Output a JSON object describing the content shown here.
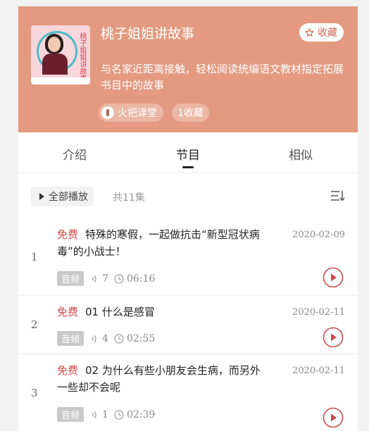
{
  "album": {
    "title": "桃子姐姐讲故事",
    "cover_text": "桃子姐姐讲故事",
    "favorite_label": "收藏",
    "description": "与名家近距离接触，轻松阅读统编语文教材指定拓展书目中的故事",
    "brand": "火把课堂",
    "favorites_count": "1收藏"
  },
  "tabs": [
    {
      "label": "介绍",
      "active": false
    },
    {
      "label": "节目",
      "active": true
    },
    {
      "label": "相似",
      "active": false
    }
  ],
  "toolbar": {
    "play_all_label": "全部播放",
    "total_label": "共11集"
  },
  "episodes": [
    {
      "num": "1",
      "free_label": "免费",
      "title": "特殊的寒假，一起做抗击“新型冠状病毒”的小战士！",
      "date": "2020-02-09",
      "type": "音频",
      "plays": "7",
      "duration": "06:16"
    },
    {
      "num": "2",
      "free_label": "免费",
      "title": "01 什么是感冒",
      "date": "2020-02-11",
      "type": "音频",
      "plays": "4",
      "duration": "02:55"
    },
    {
      "num": "3",
      "free_label": "免费",
      "title": "02 为什么有些小朋友会生病，而另外一些却不会呢",
      "date": "2020-02-11",
      "type": "音频",
      "plays": "1",
      "duration": "02:39"
    }
  ],
  "colors": {
    "header_bg": "#e39a80",
    "accent_red": "#cf4a4a"
  }
}
